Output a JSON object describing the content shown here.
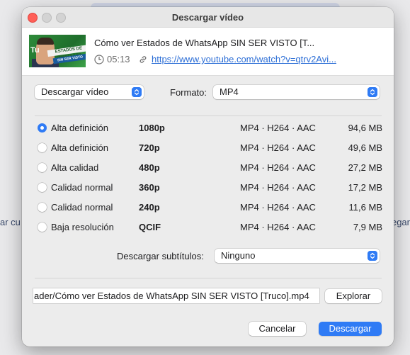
{
  "background": {
    "left_text": "ar cu",
    "right_text": "egar"
  },
  "window": {
    "title": "Descargar vídeo"
  },
  "video": {
    "title": "Cómo ver Estados de WhatsApp SIN SER VISTO [T...",
    "duration": "05:13",
    "url": "https://www.youtube.com/watch?v=qtrv2Avi...",
    "thumbnail_logo": "Tu",
    "thumbnail_text": "ESTADOS DE WHATSAPP",
    "thumbnail_text2": "SIN SER VISTO"
  },
  "options": {
    "action_selected": "Descargar vídeo",
    "format_label": "Formato:",
    "format_selected": "MP4"
  },
  "qualities": [
    {
      "label": "Alta definición",
      "resolution": "1080p",
      "codec": "MP4 · H264 · AAC",
      "size": "94,6 MB",
      "selected": true
    },
    {
      "label": "Alta definición",
      "resolution": "720p",
      "codec": "MP4 · H264 · AAC",
      "size": "49,6 MB",
      "selected": false
    },
    {
      "label": "Alta calidad",
      "resolution": "480p",
      "codec": "MP4 · H264 · AAC",
      "size": "27,2 MB",
      "selected": false
    },
    {
      "label": "Calidad normal",
      "resolution": "360p",
      "codec": "MP4 · H264 · AAC",
      "size": "17,2 MB",
      "selected": false
    },
    {
      "label": "Calidad normal",
      "resolution": "240p",
      "codec": "MP4 · H264 · AAC",
      "size": "11,6 MB",
      "selected": false
    },
    {
      "label": "Baja resolución",
      "resolution": "QCIF",
      "codec": "MP4 · H264 · AAC",
      "size": "7,9 MB",
      "selected": false
    }
  ],
  "subtitles": {
    "label": "Descargar subtítulos:",
    "selected": "Ninguno"
  },
  "output": {
    "path": "ader/Cómo ver Estados de WhatsApp SIN SER VISTO [Truco].mp4",
    "browse_label": "Explorar"
  },
  "footer": {
    "cancel_label": "Cancelar",
    "download_label": "Descargar"
  },
  "colors": {
    "accent": "#2f7bf5",
    "link": "#2c6ed6",
    "close_button": "#ff5f57"
  }
}
